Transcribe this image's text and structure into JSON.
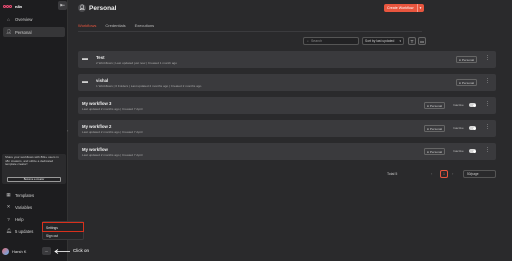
{
  "brand": {
    "name": "n8n",
    "accent": "#ea4b71",
    "primary": "#e8553e"
  },
  "sidebar": {
    "collapse_icon": "arrow-left-icon",
    "nav_top": [
      {
        "label": "Overview",
        "icon": "home-icon"
      },
      {
        "label": "Personal",
        "icon": "user-icon",
        "active": true
      }
    ],
    "promo": {
      "text": "Share your workflows with 80k+ users in n8n creators, and utilize a dedicated template creator!",
      "button": "Become a creator"
    },
    "nav_bottom": [
      {
        "label": "Templates",
        "icon": "templates-icon"
      },
      {
        "label": "Variables",
        "icon": "variables-icon"
      },
      {
        "label": "Help",
        "icon": "help-icon"
      },
      {
        "label": "5 updates",
        "icon": "bell-icon"
      }
    ],
    "user_menu": {
      "items": [
        "Settings",
        "Sign out"
      ]
    },
    "user": {
      "name": "Harsh K",
      "menu_button": "···"
    },
    "annotation": "Click on"
  },
  "header": {
    "title": "Personal",
    "create_button": "Create Workflow",
    "tabs": [
      "Workflows",
      "Credentials",
      "Executions"
    ]
  },
  "toolbar": {
    "search_placeholder": "Search",
    "sort_value": "Sort by last updated"
  },
  "list": [
    {
      "type": "folder",
      "name": "Test",
      "meta": "2 Workflows | Last updated just now | Created 1 month ago",
      "owner": "Personal"
    },
    {
      "type": "folder",
      "name": "vishal",
      "meta": "1 Workflows | 0 Folders | Last updated 2 months ago | Created 2 months ago",
      "owner": "Personal"
    },
    {
      "type": "workflow",
      "name": "My workflow 3",
      "meta": "Last updated 2 months ago | Created 7 April",
      "owner": "Personal",
      "status": "Inactive"
    },
    {
      "type": "workflow",
      "name": "My workflow 2",
      "meta": "Last updated 2 months ago | Created 7 April",
      "owner": "Personal",
      "status": "Inactive"
    },
    {
      "type": "workflow",
      "name": "My workflow",
      "meta": "Last updated 2 months ago | Created 7 April",
      "owner": "Personal",
      "status": "Inactive"
    }
  ],
  "pagination": {
    "total_label": "Total 5",
    "current_page": "1",
    "page_size": "50/page"
  }
}
